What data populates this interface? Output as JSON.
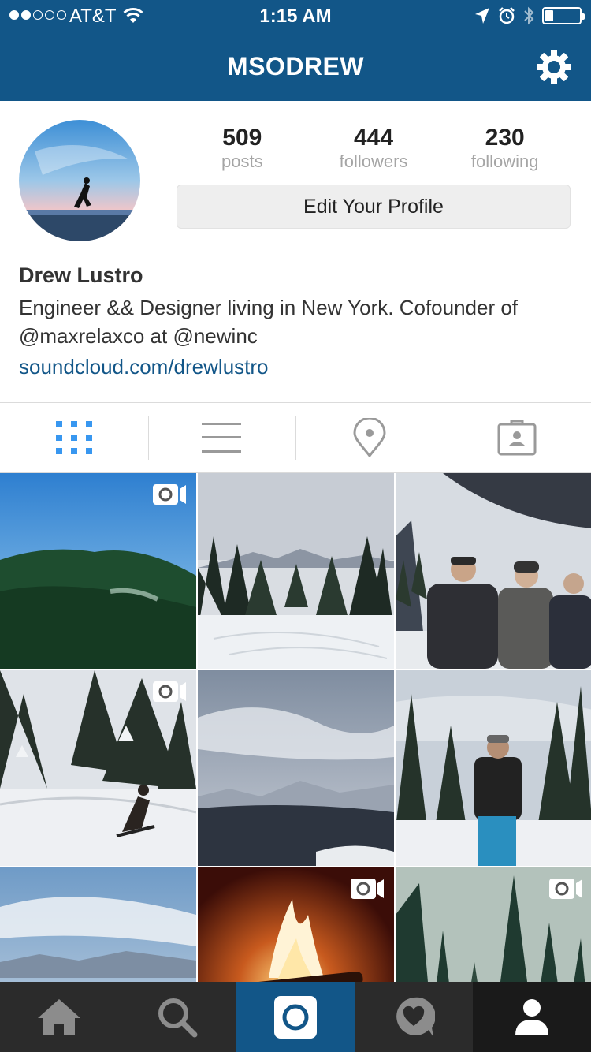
{
  "status_bar": {
    "carrier": "AT&T",
    "time": "1:15 AM",
    "signal_bars_filled": 2,
    "signal_bars_total": 5,
    "battery_level": 0.2
  },
  "nav": {
    "title": "MSODREW",
    "settings_icon": "gear-icon"
  },
  "profile": {
    "stats": [
      {
        "value": "509",
        "label": "posts"
      },
      {
        "value": "444",
        "label": "followers"
      },
      {
        "value": "230",
        "label": "following"
      }
    ],
    "edit_button": "Edit Your Profile",
    "name": "Drew Lustro",
    "bio": "Engineer && Designer living in New York. Cofounder of @maxrelaxco at @newinc",
    "website": "soundcloud.com/drewlustro"
  },
  "tabs": [
    {
      "icon": "grid-view-icon",
      "active": true
    },
    {
      "icon": "list-view-icon",
      "active": false
    },
    {
      "icon": "location-pin-icon",
      "active": false
    },
    {
      "icon": "tagged-photos-icon",
      "active": false
    }
  ],
  "colors": {
    "brand": "#125688",
    "active_tab": "#3897f0",
    "inactive_icon": "#9a9a9a",
    "bottom_bar": "#2b2b2b"
  },
  "posts": [
    {
      "subject": "forested mountain under blue sky",
      "video": true
    },
    {
      "subject": "snowy ski trail between pines",
      "video": false
    },
    {
      "subject": "three friends on ski lift",
      "video": false
    },
    {
      "subject": "snowboarder among snowy trees",
      "video": true
    },
    {
      "subject": "cloudy sky over mountain range",
      "video": false
    },
    {
      "subject": "man standing on snowy slope",
      "video": false
    },
    {
      "subject": "sky over snowy peaks",
      "video": false
    },
    {
      "subject": "fireplace flames",
      "video": true
    },
    {
      "subject": "misty pine forest",
      "video": true
    }
  ],
  "bottom_nav": [
    {
      "icon": "home-icon",
      "active": false
    },
    {
      "icon": "search-icon",
      "active": false
    },
    {
      "icon": "camera-icon",
      "active": true
    },
    {
      "icon": "activity-heart-icon",
      "active": false
    },
    {
      "icon": "profile-icon",
      "active": false
    }
  ]
}
